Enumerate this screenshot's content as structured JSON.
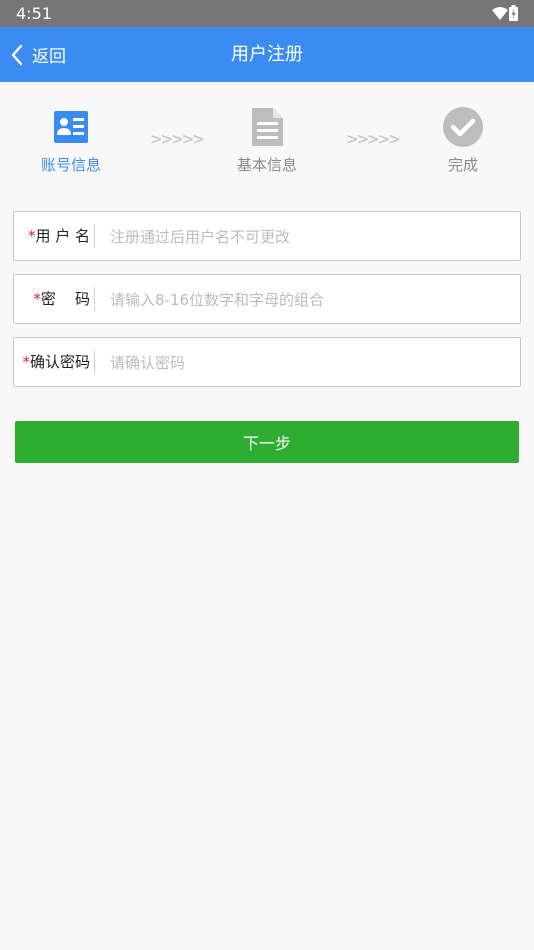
{
  "status_bar": {
    "time": "4:51"
  },
  "header": {
    "back_label": "返回",
    "title": "用户注册"
  },
  "steps": [
    {
      "label": "账号信息",
      "icon": "id-card-icon",
      "active": true
    },
    {
      "label": "基本信息",
      "icon": "document-icon",
      "active": false
    },
    {
      "label": "完成",
      "icon": "check-circle-icon",
      "active": false
    }
  ],
  "step_separator": ">>>>>",
  "form": {
    "required_mark": "*",
    "username": {
      "label": "用 户 名",
      "placeholder": "注册通过后用户名不可更改",
      "value": ""
    },
    "password": {
      "label": "密    码",
      "placeholder": "请输入8-16位数字和字母的组合",
      "value": ""
    },
    "confirm_password": {
      "label": "确认密码",
      "placeholder": "请确认密码",
      "value": ""
    }
  },
  "next_button": {
    "label": "下一步"
  },
  "colors": {
    "primary": "#3b8cf2",
    "success": "#2fad32",
    "required": "#e02020",
    "inactive_icon": "#bdbdbd"
  }
}
